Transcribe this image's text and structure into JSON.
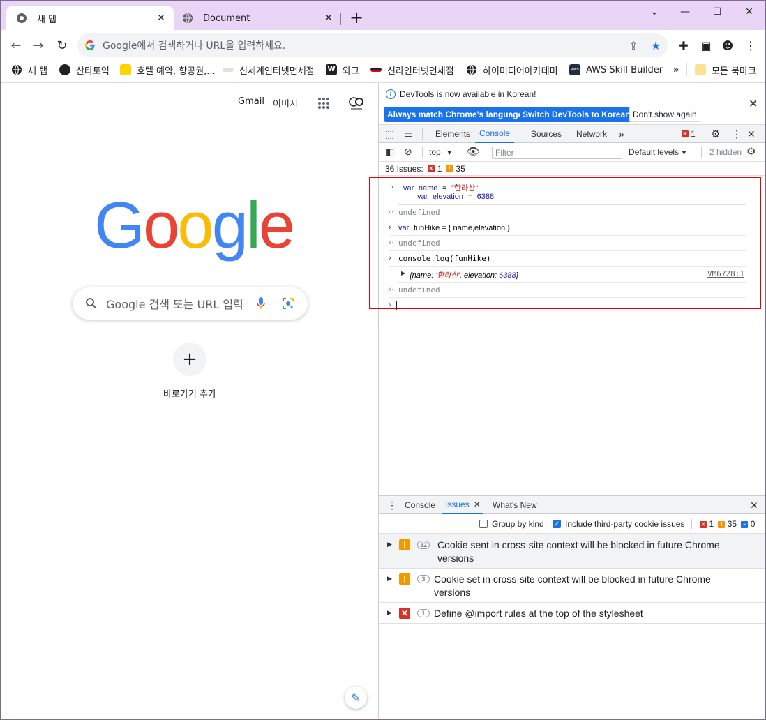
{
  "browser": {
    "tabs": [
      {
        "label": "새 탭",
        "active": true
      },
      {
        "label": "Document",
        "active": false
      }
    ],
    "omnibox_placeholder": "Google에서 검색하거나 URL을 입력하세요.",
    "bookmarks": [
      {
        "label": "새 탭",
        "icon": "globe-icon"
      },
      {
        "label": "산타토익",
        "icon": "santa-icon"
      },
      {
        "label": "호텔 예약, 항공권,...",
        "icon": "arrow-logo-icon"
      },
      {
        "label": "신세계인터넷면세점",
        "icon": "ssg-icon"
      },
      {
        "label": "와그",
        "icon": "w-logo-icon"
      },
      {
        "label": "신라인터넷면세점",
        "icon": "shilla-icon"
      },
      {
        "label": "하이미디어아카데미",
        "icon": "globe-icon"
      },
      {
        "label": "AWS Skill Builder",
        "icon": "aws-icon"
      }
    ],
    "bookmarks_overflow": "»",
    "all_bookmarks": "모든 북마크"
  },
  "page": {
    "gmail": "Gmail",
    "images": "이미지",
    "logo": "Google",
    "search_placeholder": "Google 검색 또는 URL 입력",
    "add_shortcut_label": "바로가기 추가"
  },
  "devtools": {
    "info_text": "DevTools is now available in Korean!",
    "btn_match": "Always match Chrome's language",
    "btn_switch": "Switch DevTools to Korean",
    "btn_dont_show": "Don't show again",
    "tabs": [
      "Elements",
      "Console",
      "Sources",
      "Network"
    ],
    "error_badge": "1",
    "context": "top",
    "filter_placeholder": "Filter",
    "levels": "Default levels",
    "hidden": "2 hidden",
    "issues_label": "36 Issues:",
    "issues_errors": "1",
    "issues_warnings": "35",
    "console": {
      "l1_kw": "var",
      "l1_name": "name",
      "l1_eq": "=",
      "l1_str": "\"한라산\"",
      "l2_kw": "var",
      "l2_name": "elevation",
      "l2_eq": "=",
      "l2_num": "6388",
      "undef": "undefined",
      "l3_kw": "var",
      "l3_rest": "funHike = { name,elevation }",
      "l4": "console.log(funHike)",
      "obj_open": "{name: ",
      "obj_str": "'한라산'",
      "obj_mid": ", elevation: ",
      "obj_num": "6388",
      "obj_close": "}",
      "source": "VM6728:1"
    },
    "drawer": {
      "tabs": [
        "Console",
        "Issues",
        "What's New"
      ],
      "group_by_kind": "Group by kind",
      "include_third_party": "Include third-party cookie issues",
      "count_errors": "1",
      "count_warnings": "35",
      "count_info": "0",
      "issues": [
        {
          "count": "32",
          "text_line1": "Cookie sent in cross-site context will be blocked in future Chrome",
          "text_line2": "versions",
          "kind": "warning"
        },
        {
          "count": "3",
          "text_line1": "Cookie set in cross-site context will be blocked in future Chrome",
          "text_line2": "versions",
          "kind": "warning"
        },
        {
          "count": "1",
          "text_line1": "Define @import rules at the top of the stylesheet",
          "text_line2": "",
          "kind": "error"
        }
      ]
    }
  },
  "colors": {
    "tabstrip": "#e9d5f5",
    "accent": "#1a73e8",
    "highlight_box": "#e60012",
    "google_blue": "#4285f4",
    "google_red": "#ea4335",
    "google_yellow": "#fbbc05",
    "google_green": "#34a853"
  }
}
